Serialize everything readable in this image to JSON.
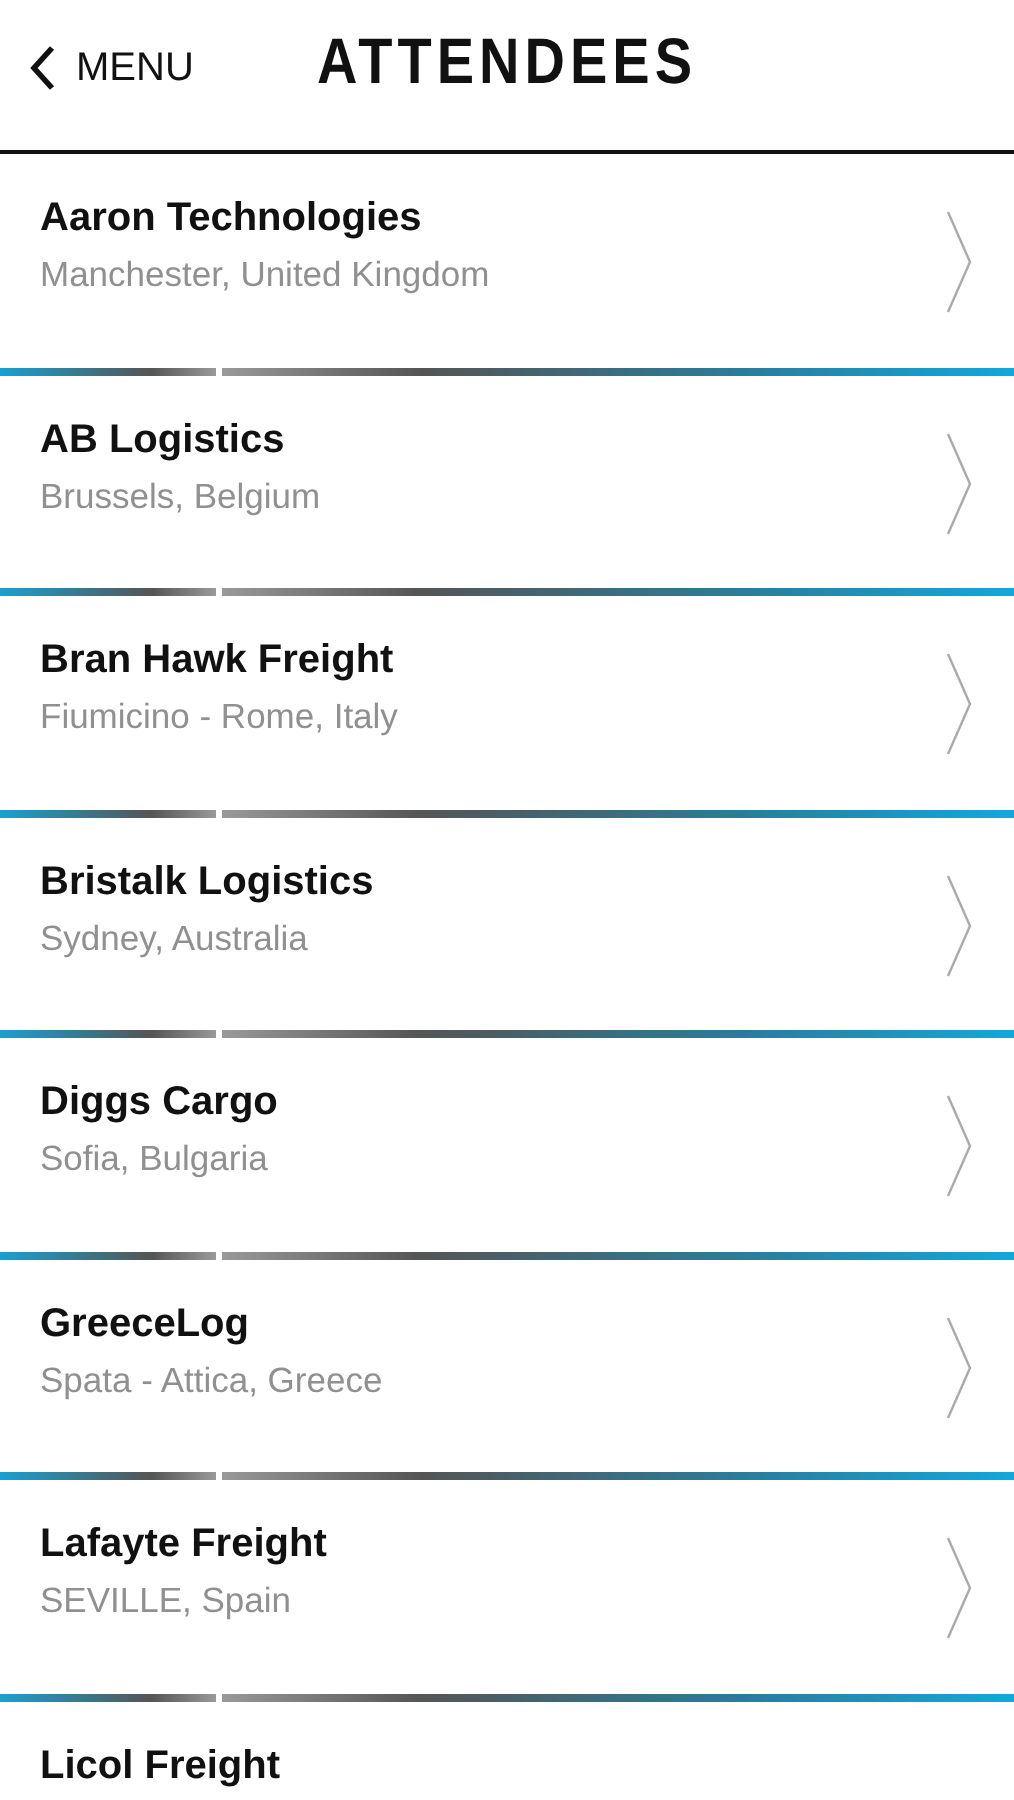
{
  "header": {
    "back_label": "MENU",
    "title": "ATTENDEES"
  },
  "attendees": [
    {
      "name": "Aaron Technologies",
      "location": "Manchester, United Kingdom"
    },
    {
      "name": "AB Logistics",
      "location": "Brussels, Belgium"
    },
    {
      "name": "Bran Hawk Freight",
      "location": "Fiumicino - Rome, Italy"
    },
    {
      "name": "Bristalk Logistics",
      "location": "Sydney, Australia"
    },
    {
      "name": "Diggs Cargo",
      "location": "Sofia, Bulgaria"
    },
    {
      "name": "GreeceLog",
      "location": "Spata - Attica, Greece"
    },
    {
      "name": "Lafayte Freight",
      "location": "SEVILLE, Spain"
    },
    {
      "name": "Licol Freight"
    }
  ]
}
